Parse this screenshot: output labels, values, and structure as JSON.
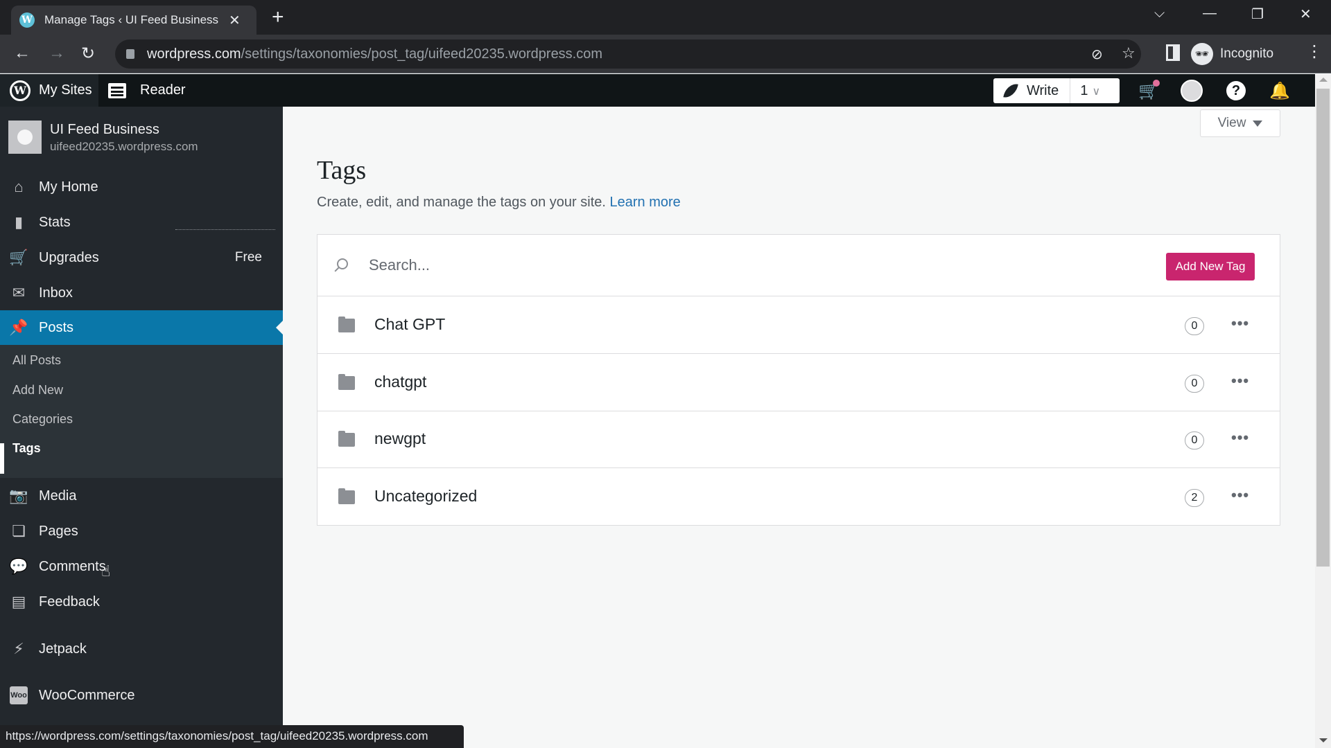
{
  "browser": {
    "tab_title": "Manage Tags ‹ UI Feed Business",
    "url_host": "wordpress.com",
    "url_path": "/settings/taxonomies/post_tag/uifeed20235.wordpress.com",
    "profile_label": "Incognito",
    "status_url": "https://wordpress.com/settings/taxonomies/post_tag/uifeed20235.wordpress.com"
  },
  "masterbar": {
    "my_sites": "My Sites",
    "reader": "Reader",
    "write": "Write",
    "draft_count": "1"
  },
  "site": {
    "name": "UI Feed Business",
    "url": "uifeed20235.wordpress.com"
  },
  "sidebar": {
    "items": [
      {
        "label": "My Home",
        "icon": "home-icon"
      },
      {
        "label": "Stats",
        "icon": "stats-icon"
      },
      {
        "label": "Upgrades",
        "icon": "cart-icon",
        "badge": "Free"
      },
      {
        "label": "Inbox",
        "icon": "mail-icon"
      },
      {
        "label": "Posts",
        "icon": "pin-icon"
      },
      {
        "label": "Media",
        "icon": "media-icon"
      },
      {
        "label": "Pages",
        "icon": "pages-icon"
      },
      {
        "label": "Comments",
        "icon": "comment-icon"
      },
      {
        "label": "Feedback",
        "icon": "feedback-icon"
      },
      {
        "label": "Jetpack",
        "icon": "jetpack-icon"
      },
      {
        "label": "WooCommerce",
        "icon": "woo-icon"
      }
    ],
    "posts_submenu": [
      "All Posts",
      "Add New",
      "Categories",
      "Tags"
    ]
  },
  "main": {
    "view_label": "View",
    "title": "Tags",
    "subtitle": "Create, edit, and manage the tags on your site.",
    "learn_more": "Learn more",
    "search_placeholder": "Search...",
    "add_button": "Add New Tag",
    "tags": [
      {
        "name": "Chat GPT",
        "count": "0"
      },
      {
        "name": "chatgpt",
        "count": "0"
      },
      {
        "name": "newgpt",
        "count": "0"
      },
      {
        "name": "Uncategorized",
        "count": "2"
      }
    ]
  },
  "colors": {
    "accent_active": "#0a77a9",
    "primary_button": "#c9256e",
    "link": "#2271b1"
  }
}
